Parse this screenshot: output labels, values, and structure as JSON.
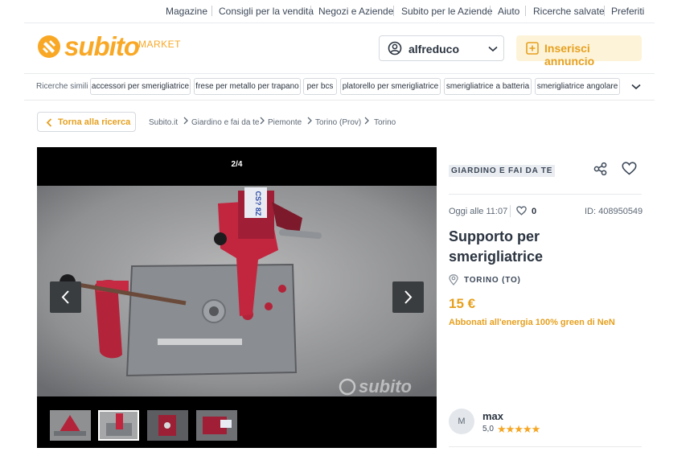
{
  "top_links": [
    "Magazine",
    "Consigli per la vendita",
    "Negozi e Aziende",
    "Subito per le Aziende",
    "Aiuto",
    "Ricerche salvate",
    "Preferiti"
  ],
  "header": {
    "logo_word": "subito",
    "logo_sub": "MARKET",
    "username": "alfreduco",
    "insert_label": "Inserisci annuncio"
  },
  "similar": {
    "label": "Ricerche simili",
    "chips": [
      "accessori per smerigliatrice",
      "frese per metallo per trapano",
      "per bcs",
      "platorello per smerigliatrice",
      "smerigliatrice a batteria",
      "smerigliatrice angolare"
    ]
  },
  "breadcrumb": {
    "back_label": "Torna alla ricerca",
    "items": [
      "Subito.it",
      "Giardino e fai da te",
      "Piemonte",
      "Torino (Prov)",
      "Torino"
    ]
  },
  "gallery": {
    "counter": "2/4",
    "watermark": "subito",
    "stamp": "CS? 8Z"
  },
  "ad": {
    "category": "GIARDINO E FAI DA TE",
    "date": "Oggi alle 11:07",
    "favorites": "0",
    "id": "ID: 408950549",
    "title": "Supporto per smerigliatrice",
    "location": "TORINO (TO)",
    "price": "15 €",
    "promo": "Abbonati all'energia 100% green di NeN"
  },
  "seller": {
    "initial": "M",
    "name": "max",
    "rating": "5,0",
    "stars": "★★★★★"
  },
  "colors": {
    "brand": "#f9a825",
    "accent": "#e6a01e",
    "text": "#2b3440"
  }
}
